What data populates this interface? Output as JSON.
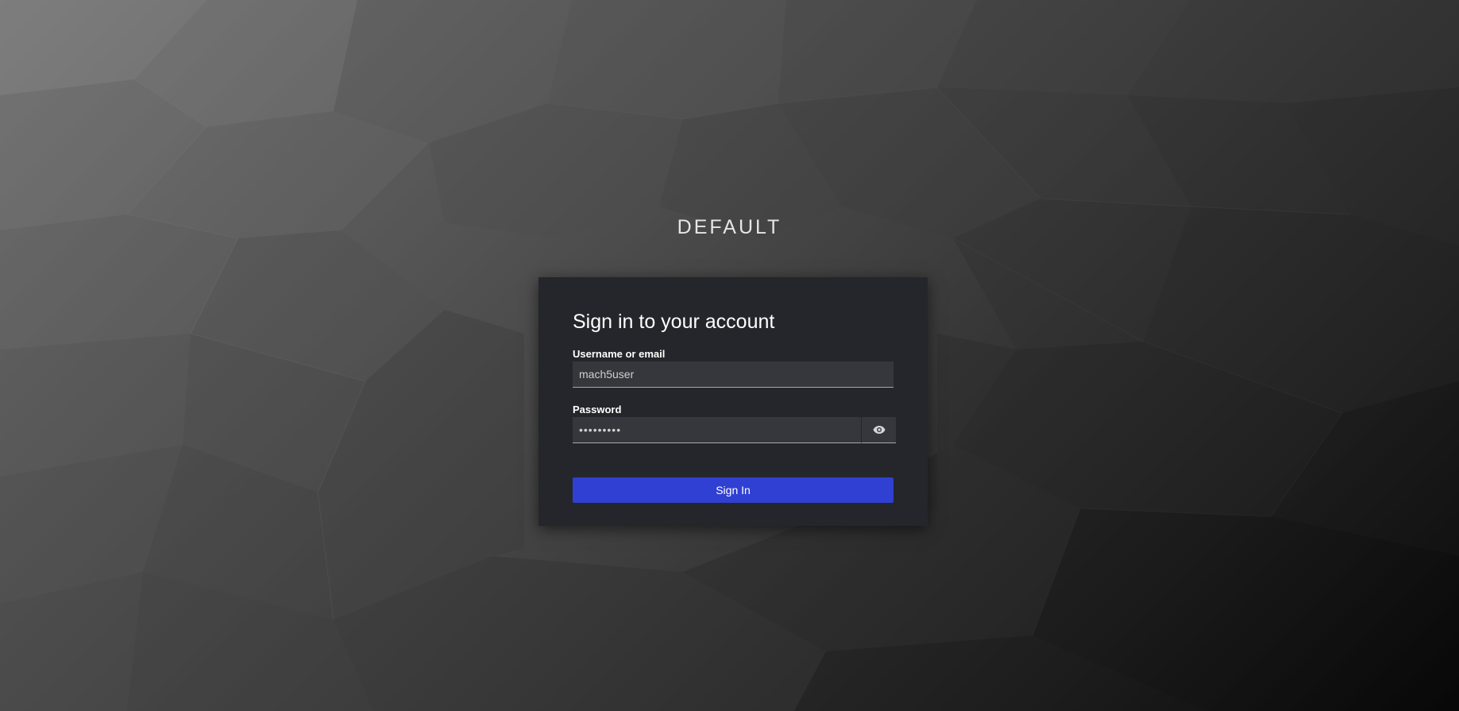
{
  "realm": {
    "title": "DEFAULT"
  },
  "login": {
    "heading": "Sign in to your account",
    "username_label": "Username or email",
    "username_value": "mach5user",
    "password_label": "Password",
    "password_value": "mach5pass",
    "show_password_icon": "eye-icon",
    "signin_label": "Sign In"
  },
  "colors": {
    "card_background": "#25262b",
    "input_background": "#36373c",
    "primary_button": "#3040d2",
    "text": "#ffffff"
  }
}
